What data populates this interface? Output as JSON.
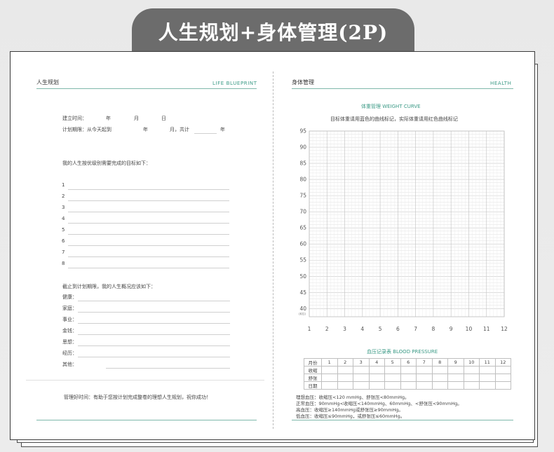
{
  "banner": {
    "title": "人生规划+身体管理(2P)"
  },
  "left": {
    "header_cn": "人生规划",
    "header_en": "LIFE BLUEPRINT",
    "created": {
      "label": "建立时间：",
      "year": "年",
      "month": "月",
      "day": "日"
    },
    "period": {
      "label": "计划期限：从今天起到",
      "year": "年",
      "month": "月，共计",
      "years": "年"
    },
    "goals_intro": "我的人生按优级别需要完成的目标如下：",
    "goal_numbers": [
      "1",
      "2",
      "3",
      "4",
      "5",
      "6",
      "7",
      "8"
    ],
    "summary_intro": "截止到计划期限，我的人生概况应该如下：",
    "aspects": [
      "健康：",
      "家庭：",
      "事业：",
      "金钱：",
      "思想：",
      "经历：",
      "其他："
    ],
    "footer": "管理好时间：有助于您按计划完成整卷的理想人生规划，祝你成功！"
  },
  "right": {
    "header_cn": "身体管理",
    "header_en": "HEALTH",
    "chart_title": "体重管理 WEIGHT CURVE",
    "chart_subtitle": "目标体重请用蓝色的曲线标记，实际体重请用红色曲线标记",
    "bp_title": "血压记录表 BLOOD PRESSURE",
    "bp_month_label": "月份",
    "bp_row_labels": [
      "收缩",
      "舒张",
      "日期"
    ],
    "bp_notes": [
      "理想血压：收缩压<120 mmHg、舒张压<80mmHg。",
      "正常血压：90mmHg<收缩压<140mmHg、60mmHg、<舒张压<90mmHg。",
      "高血压：收缩压≥140mmHg或舒张压≥90mmHg。",
      "低血压：收缩压≤90mmHg，或舒张压≤60mmHg。"
    ]
  },
  "chart_data": {
    "type": "line",
    "title": "体重管理 WEIGHT CURVE",
    "subtitle": "目标体重请用蓝色的曲线标记，实际体重请用红色曲线标记",
    "x_ticks": [
      "1",
      "2",
      "3",
      "4",
      "5",
      "6",
      "7",
      "8",
      "9",
      "10",
      "11",
      "12"
    ],
    "y_ticks": [
      "95",
      "90",
      "85",
      "80",
      "75",
      "70",
      "65",
      "60",
      "55",
      "50",
      "45",
      "40"
    ],
    "y_unit": "(KG)",
    "ylim": [
      40,
      95
    ],
    "xlim": [
      1,
      12
    ],
    "grid": true,
    "series": []
  }
}
